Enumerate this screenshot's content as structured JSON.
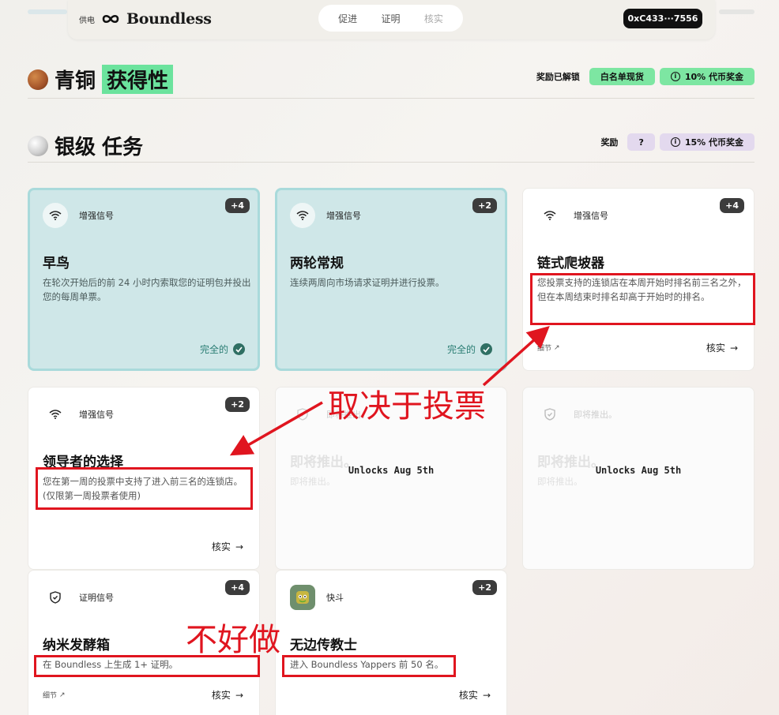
{
  "header": {
    "powered_by": "供电",
    "brand": "Boundless",
    "tabs": [
      {
        "label": "促进",
        "active": false
      },
      {
        "label": "证明",
        "active": false
      },
      {
        "label": "核实",
        "active": false
      }
    ],
    "wallet": "0xC433···7556"
  },
  "bronze": {
    "tier": "青铜",
    "title": "获得性",
    "rewards_label": "奖励已解锁",
    "reward1": "白名单现货",
    "reward2": "10% 代币奖金"
  },
  "silver": {
    "tier": "银级",
    "title": "任务",
    "rewards_label": "奖励",
    "reward1": "?",
    "reward2": "15% 代币奖金"
  },
  "cards": [
    {
      "category": "增强信号",
      "points": "+4",
      "title": "早鸟",
      "desc": "在轮次开始后的前 24 小时内索取您的证明包并投出您的每周单票。",
      "status": "完全的"
    },
    {
      "category": "增强信号",
      "points": "+2",
      "title": "两轮常规",
      "desc": "连续两周向市场请求证明并进行投票。",
      "status": "完全的"
    },
    {
      "category": "增强信号",
      "points": "+4",
      "title": "链式爬坡器",
      "desc": "您投票支持的连锁店在本周开始时排名前三名之外，但在本周结束时排名却高于开始时的排名。",
      "details": "细节",
      "verify": "核实"
    },
    {
      "category": "增强信号",
      "points": "+2",
      "title": "领导者的选择",
      "desc": "您在第一周的投票中支持了进入前三名的连锁店。(仅限第一周投票者使用)",
      "verify": "核实"
    },
    {
      "category": "即将推出。",
      "title": "即将推出。",
      "desc": "即将推出。",
      "unlock": "Unlocks Aug 5th"
    },
    {
      "category": "即将推出。",
      "title": "即将推出。",
      "desc": "即将推出。",
      "unlock": "Unlocks Aug 5th"
    },
    {
      "category": "证明信号",
      "points": "+4",
      "title": "纳米发酵箱",
      "desc": "在 Boundless 上生成 1+ 证明。",
      "details": "细节",
      "verify": "核实"
    },
    {
      "category": "快斗",
      "points": "+2",
      "title": "无边传教士",
      "desc": "进入 Boundless Yappers 前 50 名。",
      "verify": "核实"
    }
  ],
  "annotations": {
    "vote_depends": "取决于投票",
    "hard_to_do": "不好做"
  },
  "colors": {
    "annotation_red": "#e0151f",
    "accent_green": "#7de6a2",
    "accent_purple": "#e3d9ee",
    "completed_teal": "#cfe7e8"
  }
}
